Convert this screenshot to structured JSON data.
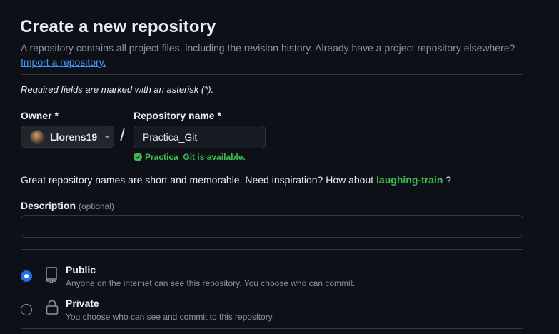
{
  "header": {
    "title": "Create a new repository",
    "intro": "A repository contains all project files, including the revision history. Already have a project repository elsewhere?",
    "import_link": "Import a repository."
  },
  "form": {
    "required_note": "Required fields are marked with an asterisk (*).",
    "owner": {
      "label": "Owner *",
      "value": "Llorens19",
      "avatar_icon": "user-avatar"
    },
    "separator": "/",
    "repo_name": {
      "label": "Repository name *",
      "value": "Practica_Git",
      "availability": "Practica_Git is available.",
      "availability_icon": "check-circle-icon"
    },
    "suggestion": {
      "text": "Great repository names are short and memorable. Need inspiration? How about",
      "name": "laughing-train",
      "suffix": "?"
    },
    "description": {
      "label": "Description",
      "optional": "(optional)",
      "value": "",
      "placeholder": ""
    },
    "visibility": [
      {
        "title": "Public",
        "description": "Anyone on the internet can see this repository. You choose who can commit.",
        "icon": "repo-icon",
        "selected": true
      },
      {
        "title": "Private",
        "description": "You choose who can see and commit to this repository.",
        "icon": "lock-icon",
        "selected": false
      }
    ]
  },
  "colors": {
    "background": "#0d1117",
    "accent_blue": "#1f6feb",
    "link_blue": "#4493f8",
    "success_green": "#3fb950",
    "muted_text": "#8b949e",
    "border": "#30363d"
  }
}
